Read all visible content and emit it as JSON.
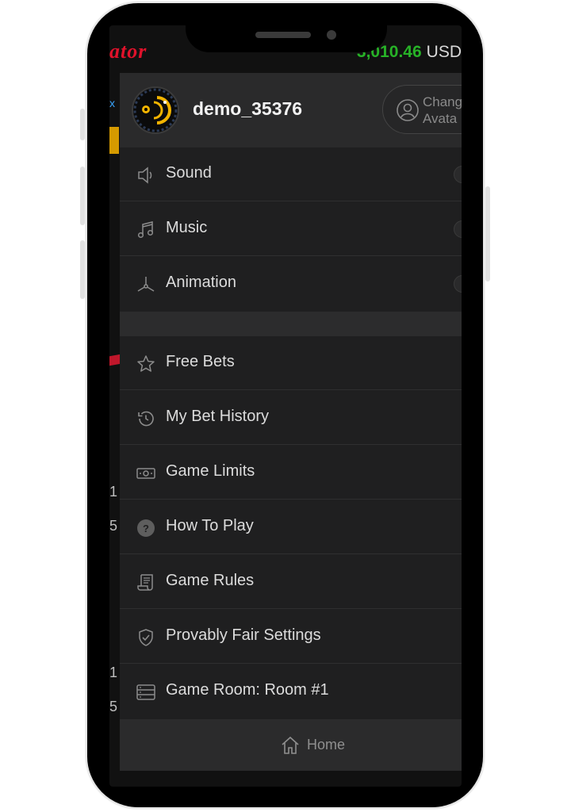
{
  "game": {
    "logo_text": "ator",
    "balance_amount": "3,010.46",
    "balance_currency": "USD",
    "bg_side_text": [
      "x",
      "1",
      "5",
      "1",
      "5"
    ]
  },
  "profile": {
    "username": "demo_35376",
    "change_avatar_label": "Chang\nAvata"
  },
  "settings": [
    {
      "label": "Sound",
      "icon": "speaker-icon"
    },
    {
      "label": "Music",
      "icon": "music-note-icon"
    },
    {
      "label": "Animation",
      "icon": "propeller-icon"
    }
  ],
  "menu_items": [
    {
      "label": "Free Bets",
      "icon": "star-icon"
    },
    {
      "label": "My Bet History",
      "icon": "history-icon"
    },
    {
      "label": "Game Limits",
      "icon": "banknote-icon"
    },
    {
      "label": "How To Play",
      "icon": "question-icon"
    },
    {
      "label": "Game Rules",
      "icon": "scroll-icon"
    },
    {
      "label": "Provably Fair Settings",
      "icon": "shield-check-icon"
    },
    {
      "label": "Game Room: Room #1",
      "icon": "server-icon"
    }
  ],
  "footer": {
    "home_label": "Home"
  },
  "colors": {
    "balance_green": "#27b227",
    "logo_red": "#e0122b",
    "menu_bg": "#1f1f20",
    "text": "#dcdcdc"
  }
}
